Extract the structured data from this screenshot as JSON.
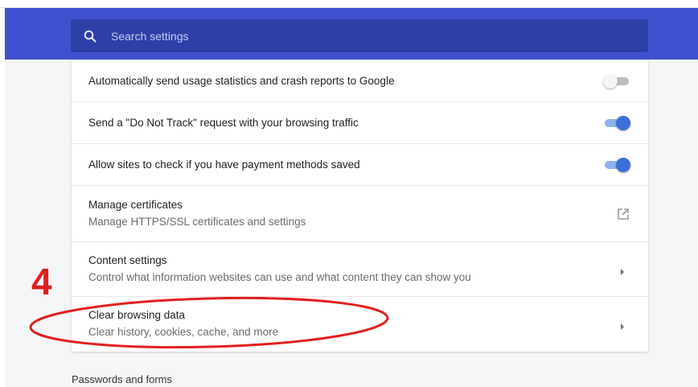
{
  "search": {
    "placeholder": "Search settings",
    "icon": "search-icon"
  },
  "colors": {
    "header": "#3f51cf",
    "search_box": "#2f3fa8",
    "toggle_on": "#3b6fdb",
    "annotation": "#e0201f"
  },
  "settings": [
    {
      "title": "Automatically send usage statistics and crash reports to Google",
      "control": "toggle",
      "enabled": false
    },
    {
      "title": "Send a \"Do Not Track\" request with your browsing traffic",
      "control": "toggle",
      "enabled": true
    },
    {
      "title": "Allow sites to check if you have payment methods saved",
      "control": "toggle",
      "enabled": true
    },
    {
      "title": "Manage certificates",
      "subtitle": "Manage HTTPS/SSL certificates and settings",
      "control": "external-link-icon"
    },
    {
      "title": "Content settings",
      "subtitle": "Control what information websites can use and what content they can show you",
      "control": "chevron-right-icon"
    },
    {
      "title": "Clear browsing data",
      "subtitle": "Clear history, cookies, cache, and more",
      "control": "chevron-right-icon"
    }
  ],
  "annotation": {
    "number": "4"
  },
  "next_section": {
    "heading": "Passwords and forms"
  }
}
